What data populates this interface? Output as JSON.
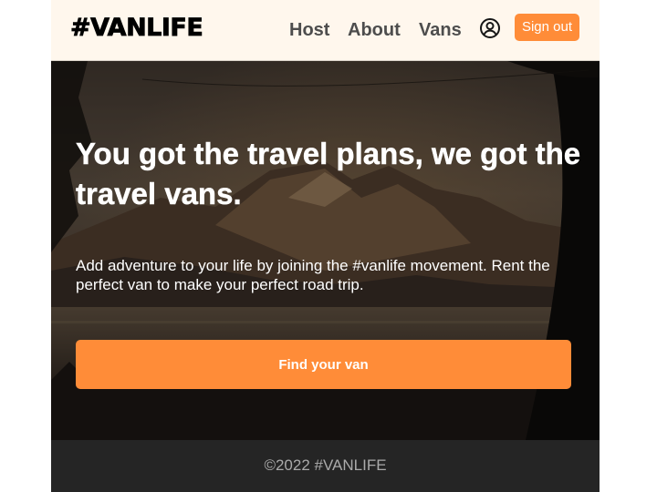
{
  "header": {
    "logo": "#VANLIFE",
    "nav": {
      "host": "Host",
      "about": "About",
      "vans": "Vans"
    },
    "profile_icon": "user-circle-icon",
    "signout_label": "Sign out"
  },
  "hero": {
    "title": "You got the travel plans, we got the travel vans.",
    "text": "Add adventure to your life by joining the #vanlife movement. Rent the perfect van to make your perfect road trip.",
    "button_label": "Find your van",
    "background": "mountain-lake-through-van-window"
  },
  "footer": {
    "text": "©2022 #VANLIFE"
  },
  "colors": {
    "accent": "#FF8C38",
    "header_bg": "#FFF7ED",
    "nav_text": "#4D4D4D",
    "footer_bg": "#252525",
    "footer_text": "#AAAAAA"
  }
}
